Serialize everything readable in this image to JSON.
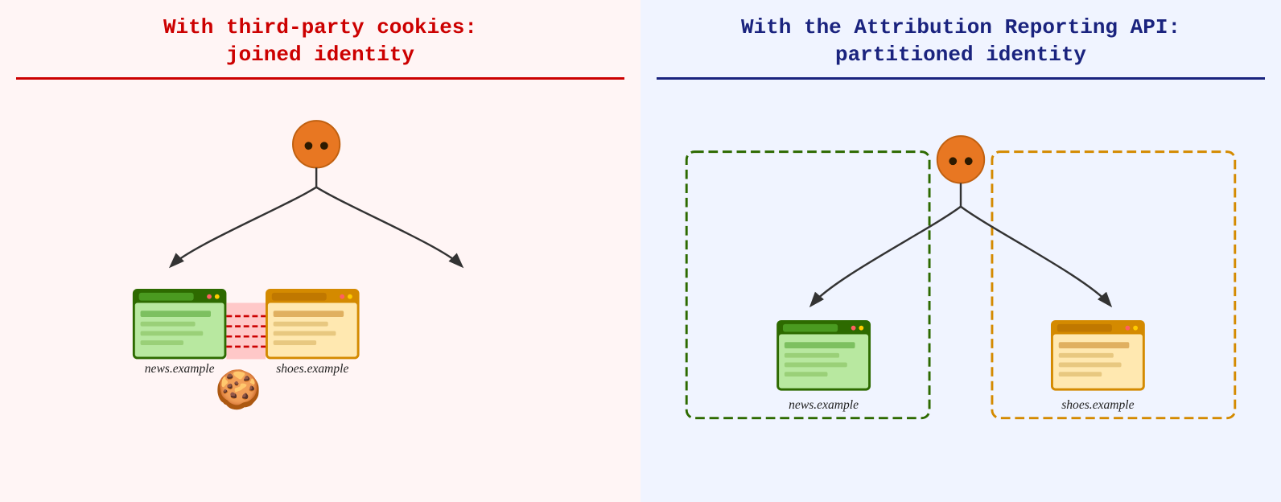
{
  "left": {
    "title_line1": "With third-party cookies:",
    "title_line2": "joined identity",
    "divider_color": "#cc0000",
    "bg": "#fff5f5",
    "site1": "news.example",
    "site2": "shoes.example"
  },
  "right": {
    "title_line1": "With the Attribution Reporting API:",
    "title_line2": "partitioned identity",
    "divider_color": "#1a237e",
    "bg": "#f0f4ff",
    "site1": "news.example",
    "site2": "shoes.example"
  }
}
